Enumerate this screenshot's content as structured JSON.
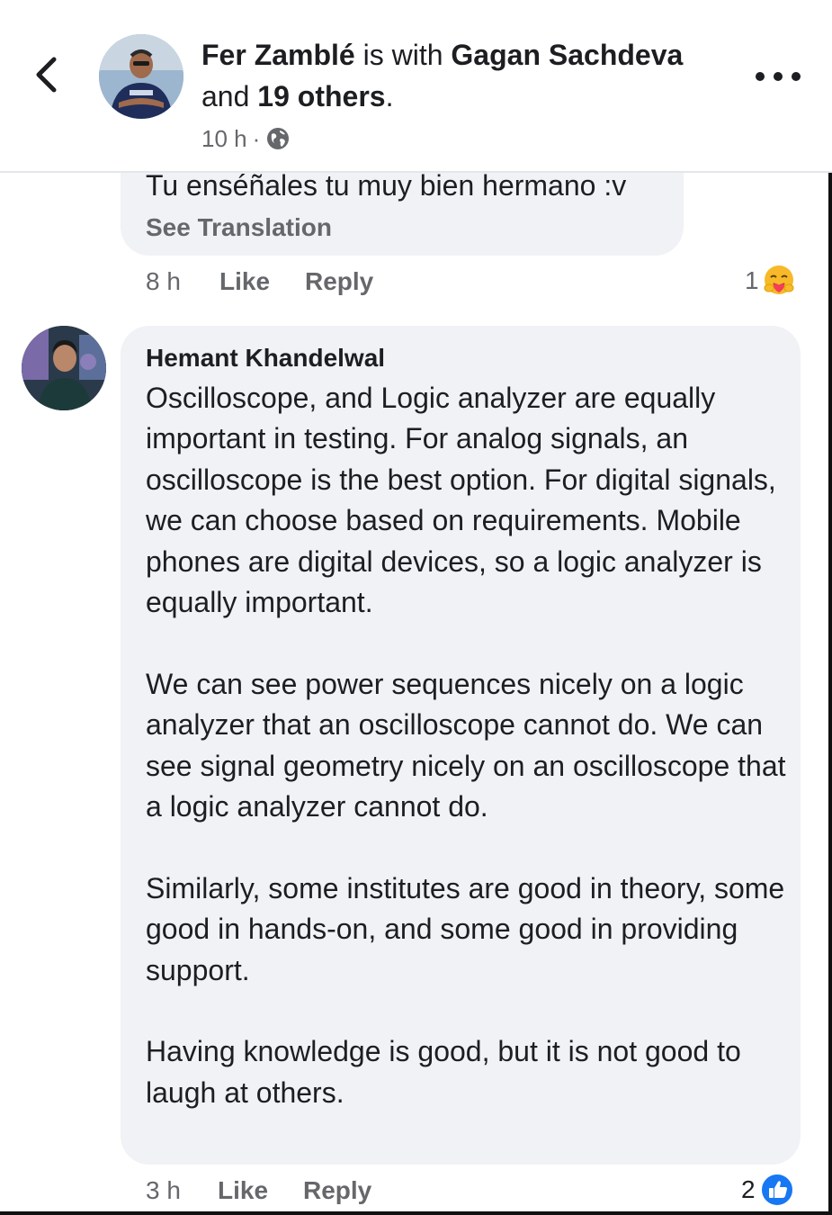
{
  "post": {
    "author": "Fer Zamblé",
    "with_text": "is with",
    "tagged_name": "Gagan Sachdeva",
    "and_text": "and",
    "others": "19 others",
    "period": ".",
    "time": "10 h",
    "meta_dot": "·",
    "privacy_icon": "globe-icon"
  },
  "comments": [
    {
      "text": "Tu enséñales tu muy bien hermano :v",
      "see_translation": "See Translation",
      "time": "8 h",
      "like_label": "Like",
      "reply_label": "Reply",
      "reaction_count": "1",
      "reaction_icon": "care-reaction-icon"
    },
    {
      "author": "Hemant Khandelwal",
      "paragraphs": [
        "Oscilloscope, and Logic analyzer are equally important in testing. For analog signals, an oscilloscope is the best option. For digital signals, we can choose based on requirements. Mobile phones are digital devices, so a logic analyzer is equally important.",
        "We can see power sequences nicely on a logic analyzer that an oscilloscope cannot do. We can see signal geometry nicely on an oscilloscope that a logic analyzer cannot do.",
        "Similarly, some institutes are good in theory, some good in hands-on, and some good in providing support.",
        "Having knowledge is good, but it is not good to laugh at others."
      ],
      "time": "3 h",
      "like_label": "Like",
      "reply_label": "Reply",
      "reaction_count": "2",
      "reaction_icon": "like-reaction-icon"
    }
  ],
  "colors": {
    "bubble": "#f0f2f5",
    "secondary_text": "#65676b",
    "like_blue": "#1877f2",
    "care_yellow": "#f7b928"
  }
}
